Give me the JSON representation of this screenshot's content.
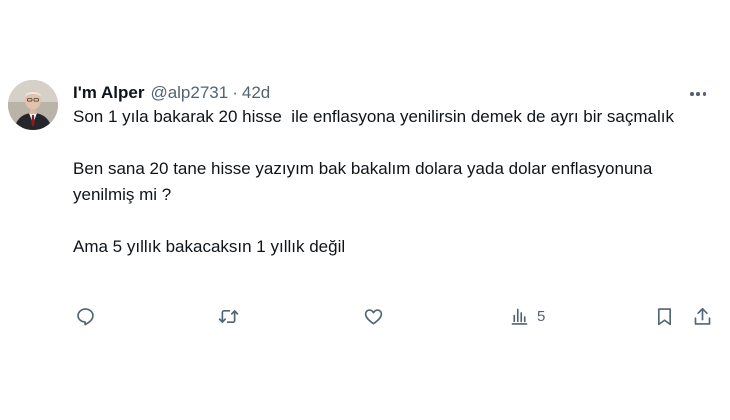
{
  "tweet": {
    "author": {
      "display_name": "I'm Alper",
      "handle": "@alp2731",
      "separator": "·",
      "time": "42d"
    },
    "paragraphs": [
      "Son 1 yıla bakarak 20 hisse  ile enflasyona yenilirsin demek de ayrı bir saçmalık",
      "Ben sana 20 tane hisse yazıyım bak bakalım dolara yada dolar enflasyonuna yenilmiş mi ?",
      "Ama 5 yıllık bakacaksın 1 yıllık değil"
    ],
    "actions": {
      "reply": {
        "icon": "reply-icon"
      },
      "retweet": {
        "icon": "retweet-icon"
      },
      "like": {
        "icon": "heart-icon"
      },
      "views": {
        "icon": "views-icon",
        "count": "5"
      },
      "bookmark": {
        "icon": "bookmark-icon"
      },
      "share": {
        "icon": "share-icon"
      }
    },
    "more_icon": "more-dots-icon",
    "colors": {
      "text": "#0f1419",
      "secondary": "#536471",
      "background": "#ffffff"
    }
  }
}
